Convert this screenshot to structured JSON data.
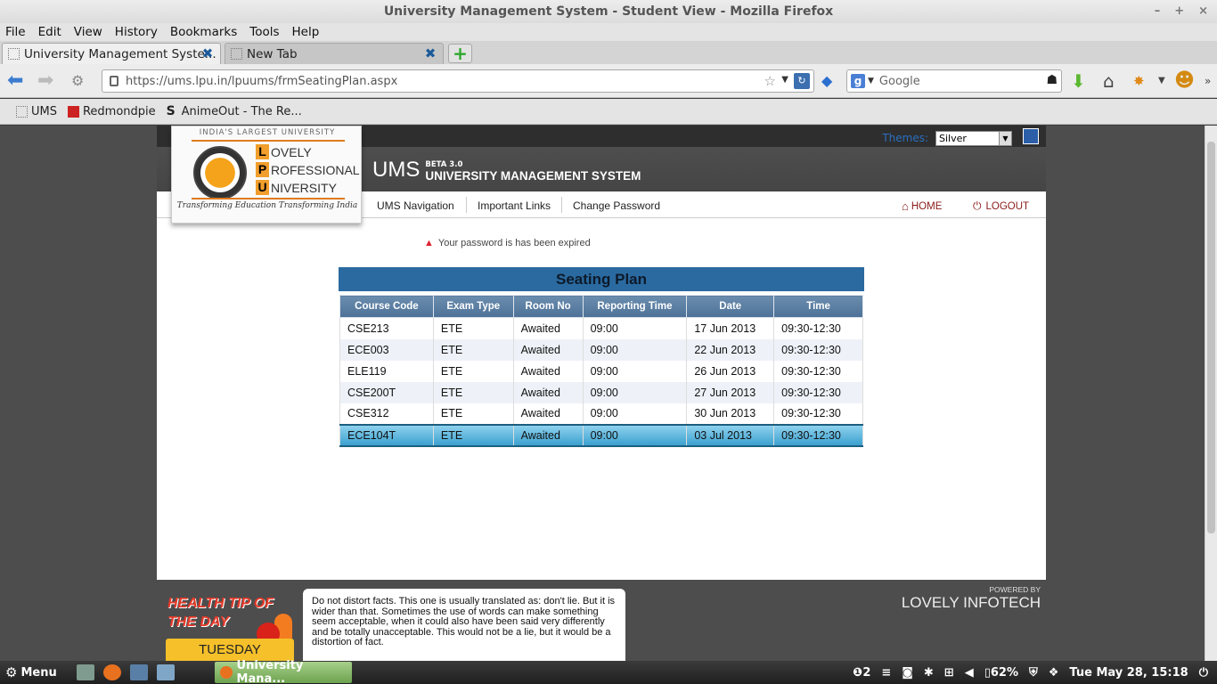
{
  "window": {
    "title": "University Management System - Student View - Mozilla Firefox",
    "controls": [
      "–",
      "+",
      "×"
    ]
  },
  "menubar": [
    "File",
    "Edit",
    "View",
    "History",
    "Bookmarks",
    "Tools",
    "Help"
  ],
  "tabs": [
    {
      "label": "University Management Syste...",
      "active": true
    },
    {
      "label": "New Tab",
      "active": false
    }
  ],
  "navbar": {
    "url": "https://ums.lpu.in/lpuums/frmSeatingPlan.aspx",
    "search_placeholder": "Google"
  },
  "bookmarks": [
    "UMS",
    "Redmondpie",
    "AnimeOut - The Re..."
  ],
  "site": {
    "themes_label": "Themes:",
    "theme_selected": "Silver",
    "logo": {
      "tagline_top": "INDIA'S LARGEST UNIVERSITY",
      "words": [
        {
          "initial": "L",
          "rest": "OVELY"
        },
        {
          "initial": "P",
          "rest": "ROFESSIONAL"
        },
        {
          "initial": "U",
          "rest": "NIVERSITY"
        }
      ],
      "slogan": "Transforming Education Transforming India"
    },
    "ums_short": "UMS",
    "beta": "BETA 3.0",
    "ums_full": "UNIVERSITY MANAGEMENT SYSTEM",
    "nav": [
      "UMS Navigation",
      "Important Links",
      "Change Password"
    ],
    "home": "HOME",
    "logout": "LOGOUT",
    "warning": "Your password is has been expired"
  },
  "seating_plan": {
    "title": "Seating Plan",
    "columns": [
      "Course Code",
      "Exam Type",
      "Room No",
      "Reporting Time",
      "Date",
      "Time"
    ],
    "rows": [
      [
        "CSE213",
        "ETE",
        "Awaited",
        "09:00",
        "17 Jun 2013",
        "09:30-12:30"
      ],
      [
        "ECE003",
        "ETE",
        "Awaited",
        "09:00",
        "22 Jun 2013",
        "09:30-12:30"
      ],
      [
        "ELE119",
        "ETE",
        "Awaited",
        "09:00",
        "26 Jun 2013",
        "09:30-12:30"
      ],
      [
        "CSE200T",
        "ETE",
        "Awaited",
        "09:00",
        "27 Jun 2013",
        "09:30-12:30"
      ],
      [
        "CSE312",
        "ETE",
        "Awaited",
        "09:00",
        "30 Jun 2013",
        "09:30-12:30"
      ],
      [
        "ECE104T",
        "ETE",
        "Awaited",
        "09:00",
        "03 Jul 2013",
        "09:30-12:30"
      ]
    ],
    "selected_row": 5
  },
  "footer": {
    "health_line1": "HEALTH TIP OF",
    "health_line2": "THE DAY",
    "day": "TUESDAY",
    "tip": "Do not distort facts. This one is usually translated as: don't lie. But it is wider than that. Sometimes the use of words can make something seem acceptable, when it could also have been said very differently and be totally unacceptable. This would not be a lie, but it would be a distortion of fact.",
    "powered_by": "POWERED BY",
    "company": "LOVELY INFOTECH"
  },
  "taskbar": {
    "menu": "Menu",
    "task": "University Mana...",
    "notifications": "2",
    "battery": "62%",
    "clock": "Tue May 28, 15:18"
  },
  "colors": {
    "table_header": "#4d7197",
    "title_bar": "#2a6aa0",
    "selected_row": "#3ba1cf",
    "warning": "#d22233",
    "logout": "#8b1a1a"
  }
}
